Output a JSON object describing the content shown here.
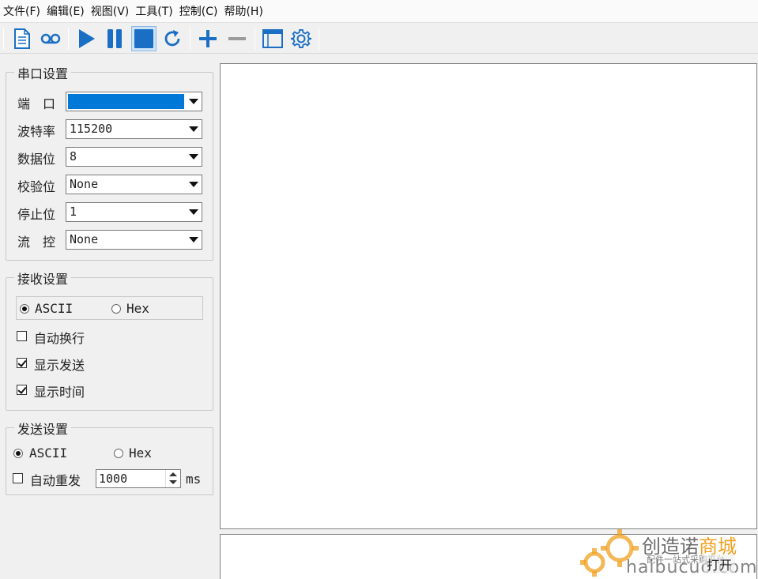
{
  "menu": [
    "文件(F)",
    "编辑(E)",
    "视图(V)",
    "工具(T)",
    "控制(C)",
    "帮助(H)"
  ],
  "toolbar": {
    "icons": [
      "new-file-icon",
      "record-icon",
      "play-icon",
      "pause-icon",
      "stop-icon",
      "refresh-icon",
      "add-icon",
      "remove-icon",
      "window-icon",
      "settings-gear-icon"
    ],
    "accent": "#1a6fc4"
  },
  "serial": {
    "title": "串口设置",
    "port_label": "端　口",
    "port_value": "",
    "baud_label": "波特率",
    "baud_value": "115200",
    "databits_label": "数据位",
    "databits_value": "8",
    "parity_label": "校验位",
    "parity_value": "None",
    "stopbits_label": "停止位",
    "stopbits_value": "1",
    "flow_label": "流　控",
    "flow_value": "None"
  },
  "receive": {
    "title": "接收设置",
    "ascii_label": "ASCII",
    "hex_label": "Hex",
    "mode": "ASCII",
    "auto_wrap_label": "自动换行",
    "auto_wrap": false,
    "show_send_label": "显示发送",
    "show_send": true,
    "show_time_label": "显示时间",
    "show_time": true
  },
  "send": {
    "title": "发送设置",
    "ascii_label": "ASCII",
    "hex_label": "Hex",
    "mode": "ASCII",
    "auto_resend_label": "自动重发",
    "auto_resend": false,
    "interval_value": "1000",
    "interval_unit": "ms"
  },
  "watermark": {
    "line1_a": "创造诺",
    "line1_b": "商城",
    "line2": "配件一站式采购平台",
    "line3": "haibucuo.com",
    "button_label": "打开"
  },
  "colors": {
    "selection": "#0078d7",
    "toolbar_blue": "#1a6fc4",
    "watermark_orange": "#f0a020"
  }
}
